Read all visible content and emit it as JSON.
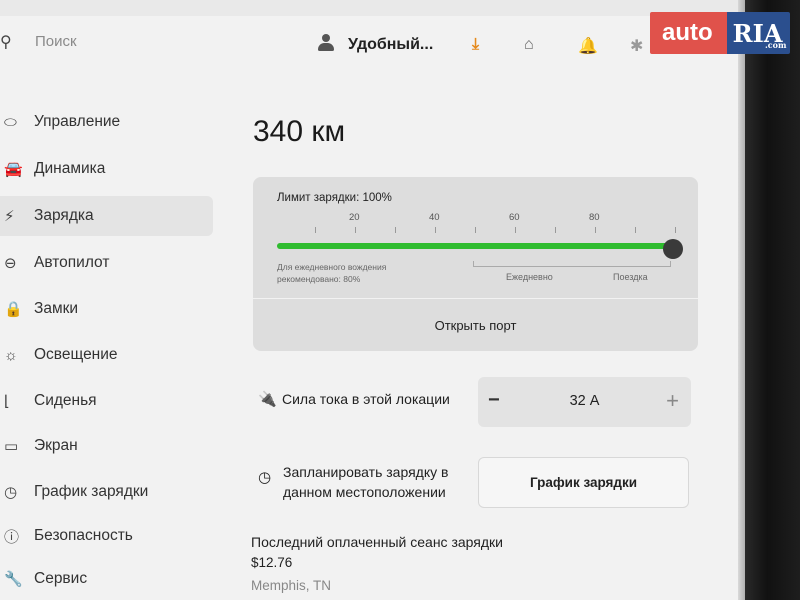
{
  "header": {
    "search_placeholder": "Поиск",
    "profile_name": "Удобный...",
    "icons": [
      "search-icon",
      "profile-icon",
      "download-icon",
      "garage-icon",
      "bell-icon",
      "bluetooth-icon",
      "network-icon"
    ]
  },
  "watermark": {
    "auto": "auto",
    "ria": "RIA",
    "com": ".com"
  },
  "sidebar": {
    "items": [
      {
        "label": "Управление",
        "icon": "toggle-icon",
        "glyph": "⬭"
      },
      {
        "label": "Динамика",
        "icon": "car-icon",
        "glyph": "🚘"
      },
      {
        "label": "Зарядка",
        "icon": "bolt-icon",
        "glyph": "⚡"
      },
      {
        "label": "Автопилот",
        "icon": "steering-wheel-icon",
        "glyph": "⊖"
      },
      {
        "label": "Замки",
        "icon": "lock-icon",
        "glyph": "🔒"
      },
      {
        "label": "Освещение",
        "icon": "sun-icon",
        "glyph": "☼"
      },
      {
        "label": "Сиденья",
        "icon": "seat-icon",
        "glyph": "⌊"
      },
      {
        "label": "Экран",
        "icon": "screen-icon",
        "glyph": "▭"
      },
      {
        "label": "График зарядки",
        "icon": "clock-icon",
        "glyph": "◷"
      },
      {
        "label": "Безопасность",
        "icon": "info-icon",
        "glyph": "ⓘ"
      },
      {
        "label": "Сервис",
        "icon": "wrench-icon",
        "glyph": "🔧"
      }
    ],
    "active_index": 2
  },
  "main": {
    "range": "340 км",
    "charge_limit_label": "Лимит зарядки: 100%",
    "charge_limit_value": 100,
    "ticks": [
      "20",
      "40",
      "60",
      "80"
    ],
    "daily_note_line1": "Для ежедневного вождения",
    "daily_note_line2": "рекомендовано: 80%",
    "daily_label": "Ежедневно",
    "trip_label": "Поездка",
    "open_port": "Открыть порт",
    "amps_label": "Сила тока в этой локации",
    "amps_minus": "−",
    "amps_value": "32 А",
    "amps_plus": "+",
    "schedule_label": "Запланировать зарядку в данном местоположении",
    "schedule_button": "График зарядки",
    "last_session_title": "Последний оплаченный сеанс зарядки",
    "last_session_price": "$12.76",
    "last_session_location": "Memphis, TN"
  },
  "colors": {
    "charge_fill": "#2fbc2f",
    "download_icon": "#e58a1c",
    "watermark_red": "#e0524b",
    "watermark_blue": "#2b4f8e"
  }
}
